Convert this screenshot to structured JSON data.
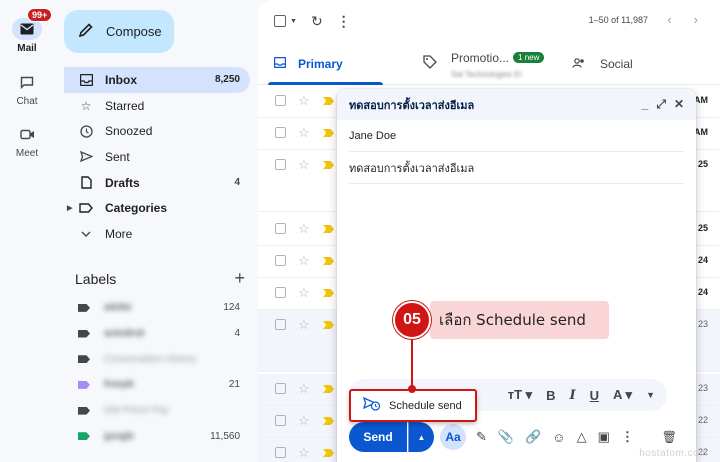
{
  "rail": [
    {
      "label": "Mail",
      "icon": "mail-icon",
      "badge": "99+",
      "active": true
    },
    {
      "label": "Chat",
      "icon": "chat-icon"
    },
    {
      "label": "Meet",
      "icon": "video-icon"
    }
  ],
  "compose_label": "Compose",
  "nav": [
    {
      "label": "Inbox",
      "count": "8,250",
      "icon": "inbox-icon",
      "active": true
    },
    {
      "label": "Starred",
      "count": "",
      "icon": "star-icon"
    },
    {
      "label": "Snoozed",
      "count": "",
      "icon": "clock-icon"
    },
    {
      "label": "Sent",
      "count": "",
      "icon": "send-icon"
    },
    {
      "label": "Drafts",
      "count": "4",
      "icon": "draft-icon",
      "bold": true
    },
    {
      "label": "Categories",
      "count": "",
      "icon": "label-icon",
      "bold": true
    },
    {
      "label": "More",
      "count": "",
      "icon": "chevron-down-icon"
    }
  ],
  "labels_title": "Labels",
  "labels": [
    {
      "name": "adobe",
      "count": "124",
      "color": "#444746"
    },
    {
      "name": "autodesk",
      "count": "4",
      "color": "#444746"
    },
    {
      "name": "Conversation History",
      "count": "",
      "color": "#444746",
      "dim": true
    },
    {
      "name": "freepik",
      "count": "21",
      "color": "#a78bfa"
    },
    {
      "name": "GM Prime Pay",
      "count": "",
      "color": "#444746",
      "dim": true
    },
    {
      "name": "google",
      "count": "11,560",
      "color": "#16a765"
    }
  ],
  "pager": "1–50 of 11,987",
  "tabs": [
    {
      "label": "Primary",
      "active": true
    },
    {
      "label": "Promotio...",
      "pill": "1 new",
      "sub": "Sat Technologies Et"
    },
    {
      "label": "Social"
    }
  ],
  "rows": [
    {
      "time": "AM",
      "bold": true
    },
    {
      "time": "AM",
      "bold": true
    },
    {
      "time": "25",
      "bold": true
    },
    {
      "time": "25",
      "bold": true
    },
    {
      "time": "24",
      "bold": true
    },
    {
      "time": "24",
      "bold": true
    },
    {
      "time": "23",
      "bold": false
    },
    {
      "time": "23",
      "bold": false
    },
    {
      "time": "22",
      "bold": false
    },
    {
      "time": "22",
      "bold": false
    }
  ],
  "compose_window": {
    "title": "ทดสอบการตั้งเวลาส่งอีเมล",
    "to": "Jane Doe",
    "subject": "ทดสอบการตั้งเวลาส่งอีเมล",
    "send_label": "Send",
    "format_label": "Aa"
  },
  "schedule_send_label": "Schedule send",
  "annotation": {
    "step": "05",
    "text": "เลือก Schedule send"
  },
  "watermark": "hostatom.com",
  "colors": {
    "accent": "#0b57d0",
    "annotation": "#d01515"
  }
}
